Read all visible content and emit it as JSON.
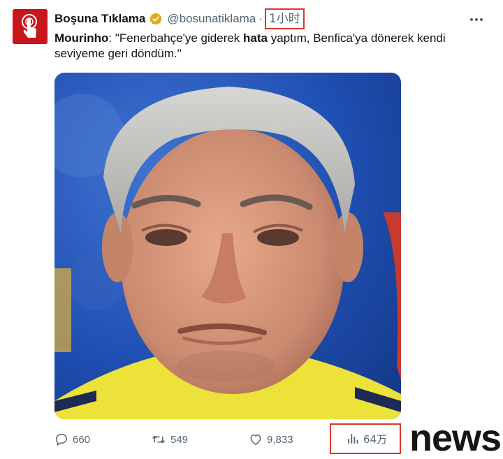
{
  "author": {
    "display_name": "Boşuna Tıklama",
    "handle": "@bosunatiklama",
    "verified": true,
    "avatar_icon": "tap-hand-icon",
    "avatar_color": "#c8161d"
  },
  "separator": "·",
  "timestamp": "1小时",
  "tweet": {
    "speaker": "Mourinho",
    "text_before": ": \"Fenerbahçe'ye giderek ",
    "bold_word": "hata",
    "text_after": " yaptım, Benfica'ya dönerek kendi seviyeme geri döndüm.\""
  },
  "media": {
    "subject": "photo-of-man-at-press-conference"
  },
  "actions": {
    "replies": "660",
    "retweets": "549",
    "likes": "9,833",
    "views": "64万"
  },
  "icons": {
    "more": "more-horizontal-icon",
    "reply": "reply-icon",
    "retweet": "retweet-icon",
    "like": "heart-icon",
    "views": "bar-chart-icon"
  },
  "highlight_color": "#e0342b",
  "watermark": "news"
}
